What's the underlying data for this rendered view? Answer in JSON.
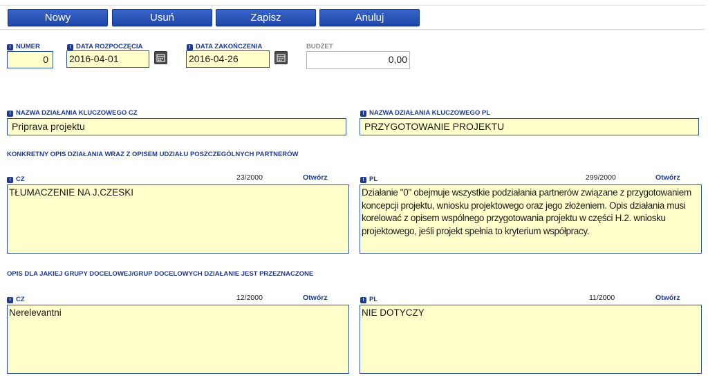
{
  "toolbar": {
    "new_label": "Nowy",
    "delete_label": "Usuń",
    "save_label": "Zapisz",
    "cancel_label": "Anuluj"
  },
  "fields": {
    "numer": {
      "label": "NUMER",
      "value": "0"
    },
    "data_rozpoczecia": {
      "label": "DATA ROZPOCZĘCIA",
      "value": "2016-04-01"
    },
    "data_zakonczenia": {
      "label": "DATA ZAKOŃCZENIA",
      "value": "2016-04-26"
    },
    "budzet": {
      "label": "BUDŻET",
      "value": "0,00"
    },
    "nazwa_cz": {
      "label": "NAZWA DZIAŁANIA KLUCZOWEGO CZ",
      "value": "Priprava projektu"
    },
    "nazwa_pl": {
      "label": "NAZWA DZIAŁANIA KLUCZOWEGO PL",
      "value": "PRZYGOTOWANIE PROJEKTU"
    }
  },
  "section_opis": {
    "heading": "KONKRETNY OPIS DZIAŁANIA WRAZ Z OPISEM UDZIAŁU POSZCZEGÓLNYCH PARTNERÓW",
    "cz": {
      "label": "CZ",
      "counter": "23/2000",
      "open": "Otwórz",
      "value": "TŁUMACZENIE NA J.CZESKI"
    },
    "pl": {
      "label": "PL",
      "counter": "299/2000",
      "open": "Otwórz",
      "value": "Działanie \"0\" obejmuje wszystkie podziałania partnerów związane z przygotowaniem koncepcji projektu, wniosku projektowego oraz jego złożeniem. Opis działania musi korelować z opisem wspólnego przygotowania projektu w części H.2. wniosku projektowego, jeśli projekt spełnia to kryterium współpracy."
    }
  },
  "section_grupy": {
    "heading": "OPIS DLA JAKIEJ GRUPY DOCELOWEJ/GRUP DOCELOWYCH DZIAŁANIE JEST PRZEZNACZONE",
    "cz": {
      "label": "CZ",
      "counter": "12/2000",
      "open": "Otwórz",
      "value": "Nerelevantni"
    },
    "pl": {
      "label": "PL",
      "counter": "11/2000",
      "open": "Otwórz",
      "value": "NIE DOTYCZY"
    }
  },
  "icons": {
    "required": "exclamation-badge-icon",
    "calendar": "calendar-icon"
  },
  "colors": {
    "button": "#2a55b8",
    "label": "#1f3a93",
    "field_bg": "#ffffcc",
    "field_border": "#2e4e9e"
  }
}
